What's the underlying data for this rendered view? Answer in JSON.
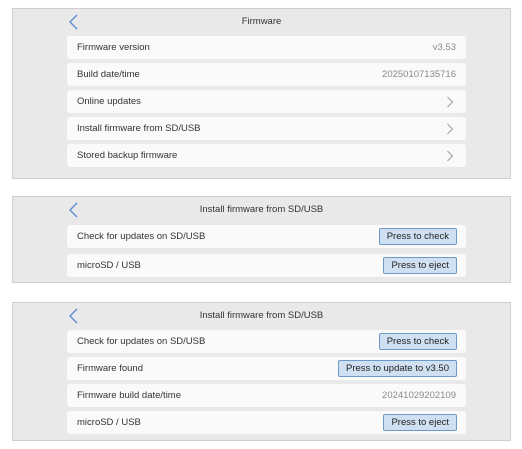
{
  "firmware": {
    "title": "Firmware",
    "rows": [
      {
        "label": "Firmware version",
        "value": "v3.53"
      },
      {
        "label": "Build date/time",
        "value": "20250107135716"
      },
      {
        "label": "Online updates"
      },
      {
        "label": "Install firmware from SD/USB"
      },
      {
        "label": "Stored backup firmware"
      }
    ]
  },
  "install_initial": {
    "title": "Install firmware from SD/USB",
    "check_label": "Check for updates on SD/USB",
    "check_button": "Press to check",
    "media_label": "microSD / USB",
    "eject_button": "Press to eject"
  },
  "install_found": {
    "title": "Install firmware from SD/USB",
    "check_label": "Check for updates on SD/USB",
    "check_button": "Press to check",
    "found_label": "Firmware found",
    "update_button": "Press to update to v3.50",
    "build_label": "Firmware build date/time",
    "build_value": "20241029202109",
    "media_label": "microSD / USB",
    "eject_button": "Press to eject"
  },
  "icons": {
    "back": "chevron-left-icon",
    "forward": "chevron-right-icon"
  },
  "colors": {
    "panel_bg": "#e9e9e9",
    "row_bg": "#fafafa",
    "button_bg": "#cfe0f2",
    "button_border": "#6f98c7",
    "back_icon": "#5b8fd0"
  }
}
